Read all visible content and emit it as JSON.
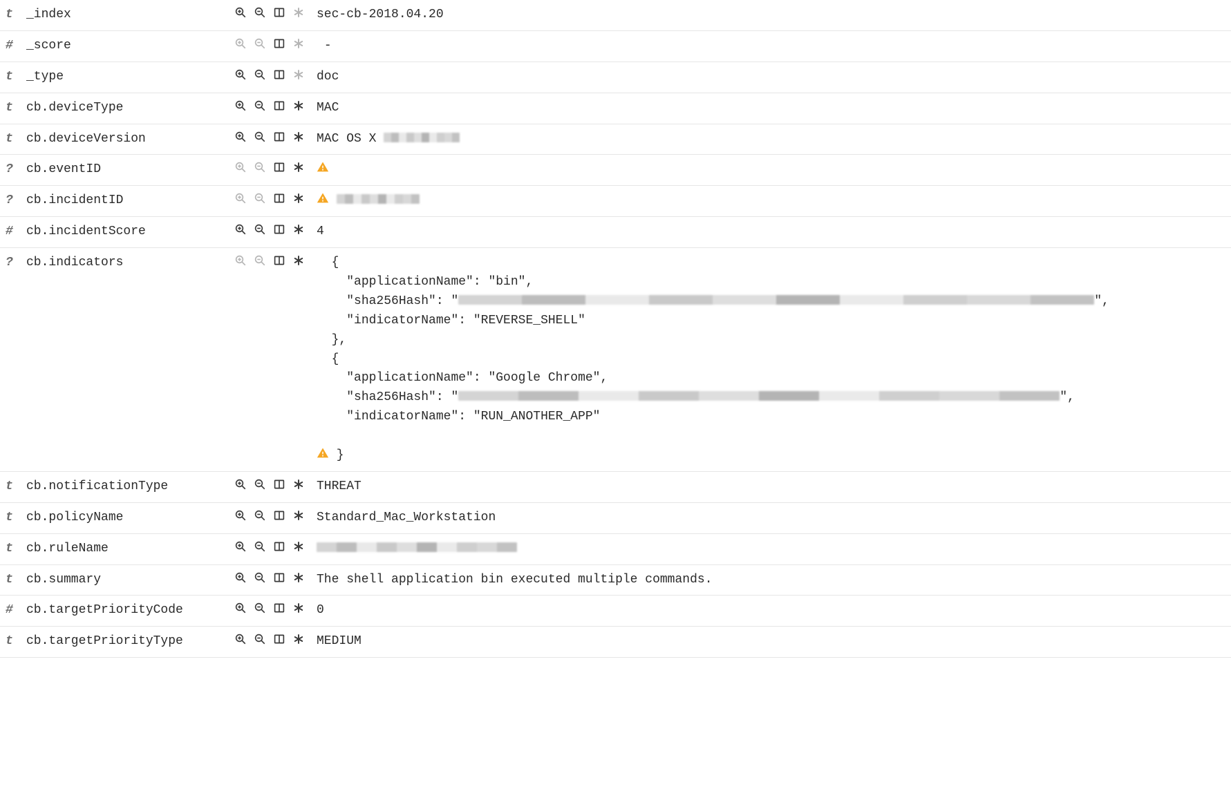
{
  "icons": {
    "type_t": "t",
    "type_hash": "#",
    "type_q": "?"
  },
  "fields": [
    {
      "type": "t",
      "name": "_index",
      "value": "sec-cb-2018.04.20",
      "dim": false,
      "asterisk_dim": true,
      "warn": false
    },
    {
      "type": "hash",
      "name": "_score",
      "value": " -",
      "dim": true,
      "asterisk_dim": true,
      "warn": false
    },
    {
      "type": "t",
      "name": "_type",
      "value": "doc",
      "dim": false,
      "asterisk_dim": true,
      "warn": false
    },
    {
      "type": "t",
      "name": "cb.deviceType",
      "value": "MAC",
      "dim": false,
      "asterisk_dim": false,
      "warn": false
    },
    {
      "type": "t",
      "name": "cb.deviceVersion",
      "value": "MAC OS X ",
      "dim": false,
      "asterisk_dim": false,
      "warn": false,
      "redact_after": 110
    },
    {
      "type": "q",
      "name": "cb.eventID",
      "value": "",
      "dim": true,
      "asterisk_dim": false,
      "warn": true
    },
    {
      "type": "q",
      "name": "cb.incidentID",
      "value": "",
      "dim": true,
      "asterisk_dim": false,
      "warn": true,
      "redact_after": 120
    },
    {
      "type": "hash",
      "name": "cb.incidentScore",
      "value": "4",
      "dim": false,
      "asterisk_dim": false,
      "warn": false
    },
    {
      "type": "q",
      "name": "cb.indicators",
      "value": "__indicators__",
      "dim": true,
      "asterisk_dim": false,
      "warn": false
    },
    {
      "type": "t",
      "name": "cb.notificationType",
      "value": "THREAT",
      "dim": false,
      "asterisk_dim": false,
      "warn": false
    },
    {
      "type": "t",
      "name": "cb.policyName",
      "value": "Standard_Mac_Workstation",
      "dim": false,
      "asterisk_dim": false,
      "warn": false
    },
    {
      "type": "t",
      "name": "cb.ruleName",
      "value": "",
      "dim": false,
      "asterisk_dim": false,
      "warn": false,
      "redact_after": 290
    },
    {
      "type": "t",
      "name": "cb.summary",
      "value": "The shell application bin executed multiple commands.",
      "dim": false,
      "asterisk_dim": false,
      "warn": false
    },
    {
      "type": "hash",
      "name": "cb.targetPriorityCode",
      "value": "0",
      "dim": false,
      "asterisk_dim": false,
      "warn": false
    },
    {
      "type": "t",
      "name": "cb.targetPriorityType",
      "value": "MEDIUM",
      "dim": false,
      "asterisk_dim": false,
      "warn": false
    }
  ],
  "indicators": {
    "prefix_line1": "  {",
    "app_label": "    \"applicationName\": ",
    "hash_label": "    \"sha256Hash\": ",
    "ind_label": "    \"indicatorName\": ",
    "close_obj": "  },",
    "open_obj": "  {",
    "close_final": "}",
    "items": [
      {
        "applicationName": "\"bin\",",
        "indicatorName": "\"REVERSE_SHELL\"",
        "hash_redact": 920
      },
      {
        "applicationName": "\"Google Chrome\",",
        "indicatorName": "\"RUN_ANOTHER_APP\"",
        "hash_redact": 870
      }
    ]
  }
}
